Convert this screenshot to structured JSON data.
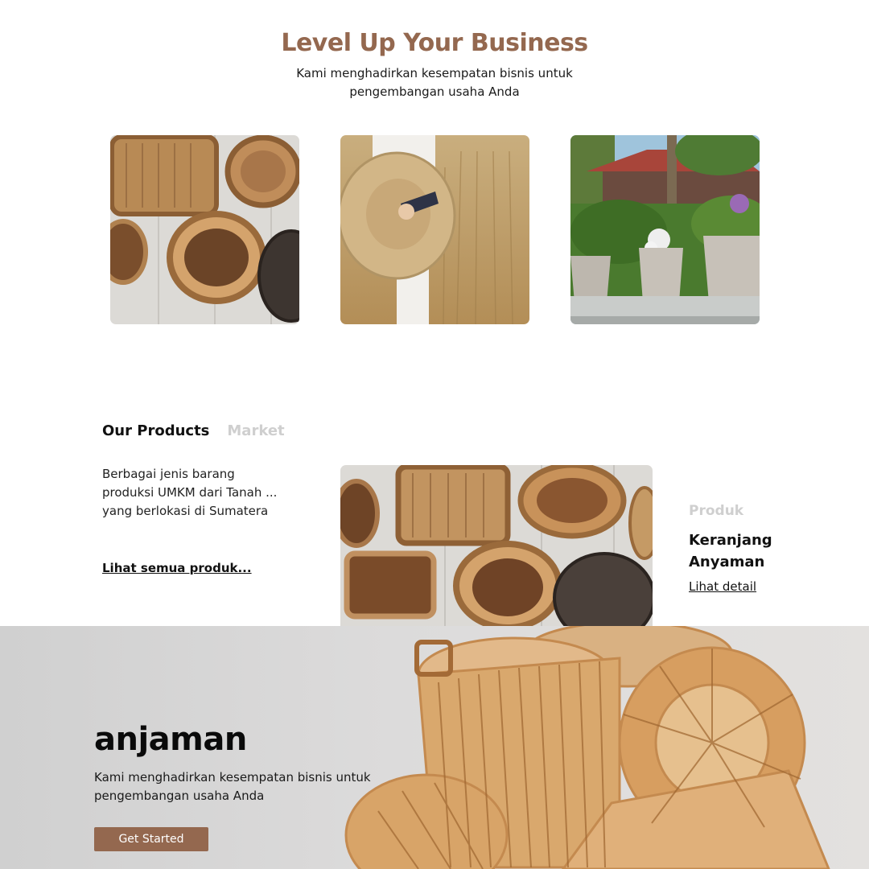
{
  "hero": {
    "title": "Level Up Your Business",
    "subtitle": "Kami menghadirkan kesempatan bisnis untuk pengembangan usaha Anda"
  },
  "gallery": {
    "images": [
      "woven-baskets-photo",
      "straw-hat-wheat-field-photo",
      "woven-planters-garden-photo"
    ]
  },
  "products": {
    "tabs": [
      {
        "label": "Our Products",
        "active": true
      },
      {
        "label": "Market",
        "active": false
      }
    ],
    "description": "Berbagai jenis barang produksi UMKM dari Tanah ... yang berlokasi di Sumatera",
    "see_all": "Lihat semua produk...",
    "featured": {
      "category": "Produk",
      "name": "Keranjang Anyaman",
      "detail_link": "Lihat detail"
    }
  },
  "banner": {
    "brand": "anjaman",
    "subtitle": "Kami menghadirkan kesempatan bisnis untuk pengembangan usaha Anda",
    "cta": "Get Started"
  },
  "colors": {
    "accent": "#94684f",
    "muted": "#cfcfcf",
    "text": "#111111"
  }
}
